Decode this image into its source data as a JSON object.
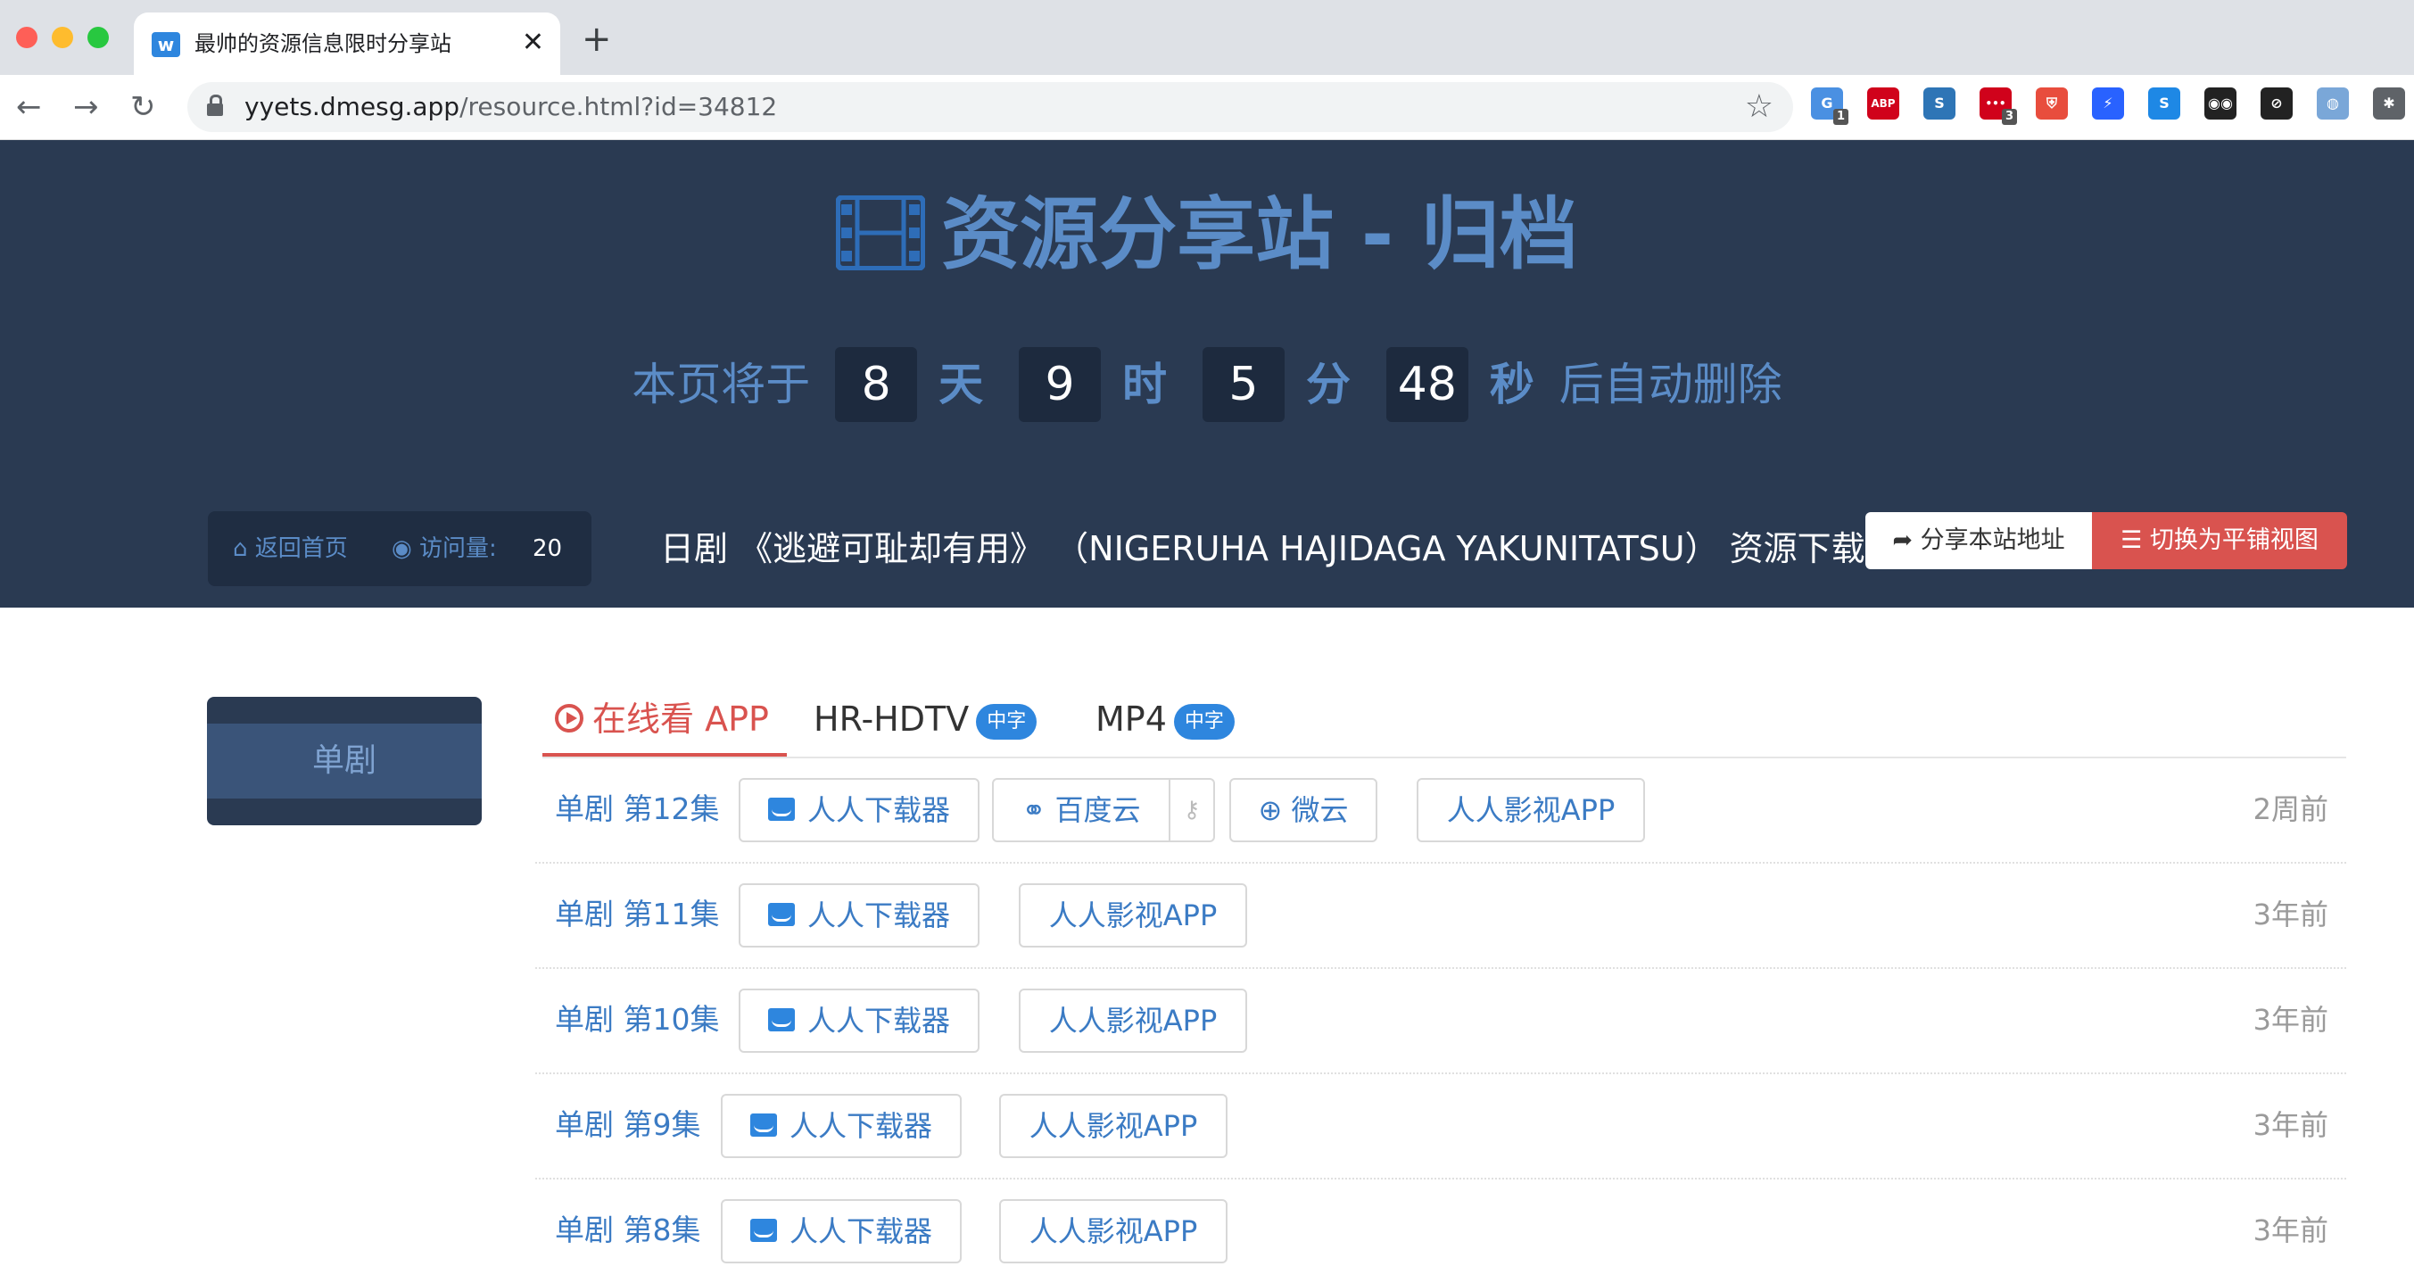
{
  "browser": {
    "tab_title": "最帅的资源信息限时分享站",
    "tab_close": "✕",
    "new_tab": "+",
    "url_host": "yyets.dmesg.app",
    "url_path": "/resource.html?id=34812",
    "back": "←",
    "forward": "→",
    "reload": "↻",
    "star": "☆",
    "extensions": [
      {
        "name": "g-extension-icon",
        "label": "G",
        "badge": "1",
        "color": "#4a90e2"
      },
      {
        "name": "adblock-plus-icon",
        "label": "ABP",
        "color": "#d0021b"
      },
      {
        "name": "s-extension-icon",
        "label": "S",
        "color": "#2e75b6"
      },
      {
        "name": "dots-extension-icon",
        "label": "•••",
        "badge": "3",
        "color": "#d0021b"
      },
      {
        "name": "shield-extension-icon",
        "label": "⛨",
        "color": "#e84d3d"
      },
      {
        "name": "bolt-extension-icon",
        "label": "⚡",
        "color": "#2962ff"
      },
      {
        "name": "s-blue-extension-icon",
        "label": "S",
        "color": "#1e88e5"
      },
      {
        "name": "glasses-extension-icon",
        "label": "◉◉",
        "color": "#222222"
      },
      {
        "name": "block-extension-icon",
        "label": "⊘",
        "color": "#222222"
      },
      {
        "name": "avatar-extension-icon",
        "label": "◍",
        "color": "#7aa7d8"
      },
      {
        "name": "puzzle-extension-icon",
        "label": "✱",
        "color": "#5f6368"
      }
    ]
  },
  "header": {
    "site_title": "资源分享站 - 归档",
    "countdown": {
      "prefix": "本页将于",
      "days": "8",
      "days_unit": "天",
      "hours": "9",
      "hours_unit": "时",
      "minutes": "5",
      "minutes_unit": "分",
      "seconds": "48",
      "seconds_unit": "秒",
      "suffix": "后自动删除"
    },
    "home_link": "返回首页",
    "visits_label": "访问量:",
    "visits_count": "20",
    "resource_title": "日剧 《逃避可耻却有用》 （NIGERUHA HAJIDAGA YAKUNITATSU） 资源下载",
    "share_button": "分享本站地址",
    "tile_button": "切换为平铺视图"
  },
  "sidebar": {
    "season": "单剧"
  },
  "tabs": [
    {
      "label": "在线看 APP",
      "badge": ""
    },
    {
      "label": "HR-HDTV",
      "badge": "中字"
    },
    {
      "label": "MP4",
      "badge": "中字"
    }
  ],
  "episodes": [
    {
      "label": "单剧 第12集",
      "downloader": "人人下载器",
      "baidu": "百度云",
      "weiyun": "微云",
      "app": "人人影视APP",
      "time": "2周前"
    },
    {
      "label": "单剧 第11集",
      "downloader": "人人下载器",
      "app": "人人影视APP",
      "time": "3年前"
    },
    {
      "label": "单剧 第10集",
      "downloader": "人人下载器",
      "app": "人人影视APP",
      "time": "3年前"
    },
    {
      "label": "单剧 第9集",
      "downloader": "人人下载器",
      "app": "人人影视APP",
      "time": "3年前"
    },
    {
      "label": "单剧 第8集",
      "downloader": "人人下载器",
      "app": "人人影视APP",
      "time": "3年前"
    }
  ]
}
